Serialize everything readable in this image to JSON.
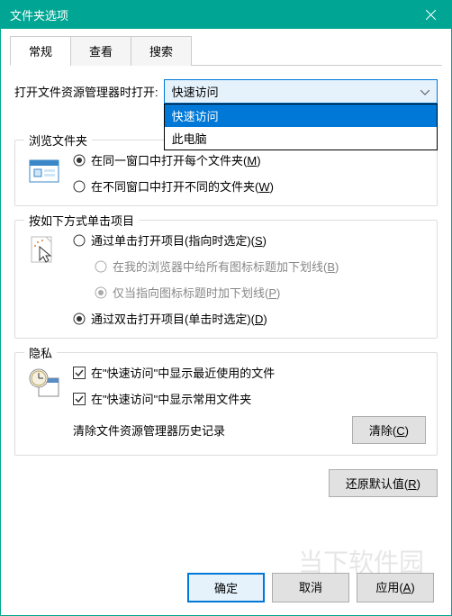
{
  "titlebar": {
    "title": "文件夹选项"
  },
  "tabs": [
    {
      "label": "常规"
    },
    {
      "label": "查看"
    },
    {
      "label": "搜索"
    }
  ],
  "openWith": {
    "label": "打开文件资源管理器时打开:",
    "selected": "快速访问",
    "options": [
      "快速访问",
      "此电脑"
    ]
  },
  "browse": {
    "title": "浏览文件夹",
    "opt1": "在同一窗口中打开每个文件夹(",
    "opt1_key": "M",
    "opt2": "在不同窗口中打开不同的文件夹(",
    "opt2_key": "W"
  },
  "click": {
    "title": "按如下方式单击项目",
    "opt1": "通过单击打开项目(指向时选定)(",
    "opt1_key": "S",
    "sub1": "在我的浏览器中给所有图标标题加下划线(",
    "sub1_key": "B",
    "sub2": "仅当指向图标标题时加下划线(",
    "sub2_key": "P",
    "opt2": "通过双击打开项目(单击时选定)(",
    "opt2_key": "D"
  },
  "privacy": {
    "title": "隐私",
    "chk1": "在\"快速访问\"中显示最近使用的文件",
    "chk2": "在\"快速访问\"中显示常用文件夹",
    "clear_label": "清除文件资源管理器历史记录",
    "clear_btn": "清除(",
    "clear_key": "C"
  },
  "restore": {
    "label": "还原默认值(",
    "key": "R"
  },
  "buttons": {
    "ok": "确定",
    "cancel": "取消",
    "apply": "应用(",
    "apply_key": "A"
  },
  "closeParen": ")",
  "watermark": "当下软件园"
}
